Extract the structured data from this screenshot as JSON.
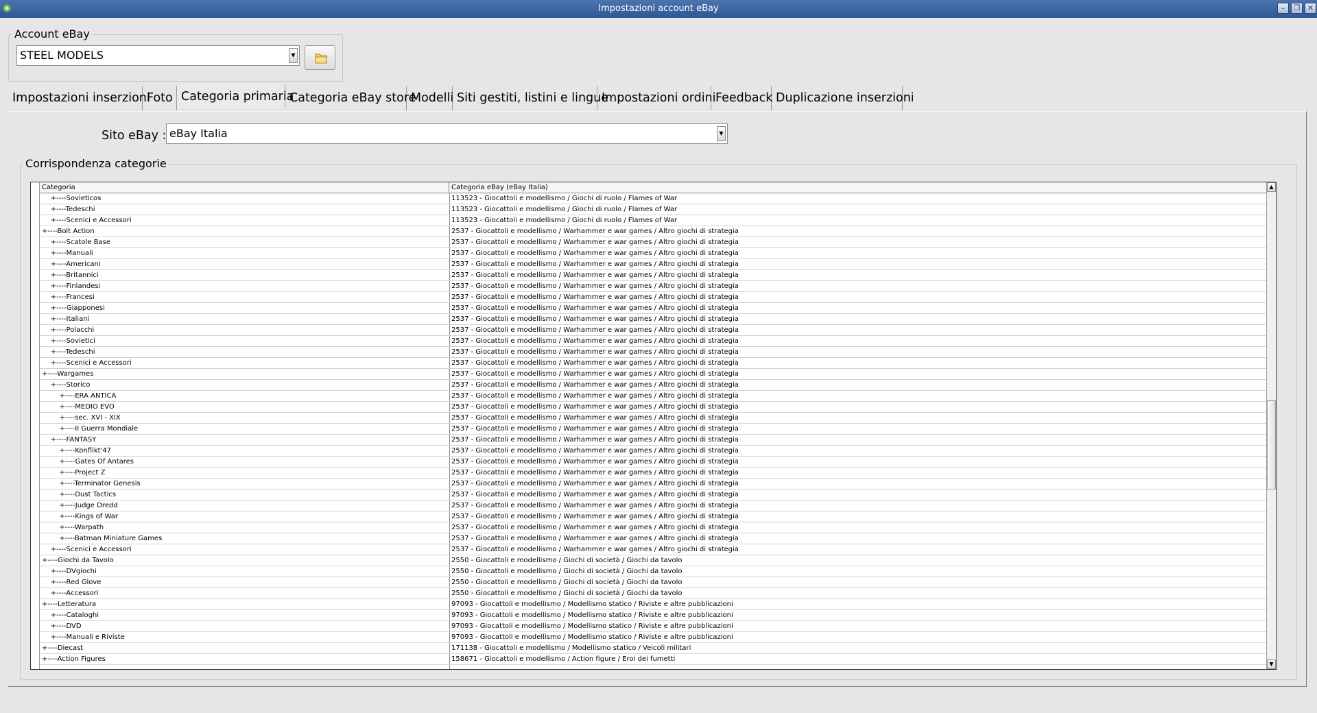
{
  "window": {
    "title": "Impostazioni account eBay",
    "buttons": {
      "minimize": "–",
      "restore": "❐",
      "close": "✕"
    }
  },
  "account": {
    "legend": "Account eBay",
    "selected": "STEEL MODELS",
    "folder_icon": "folder-icon"
  },
  "tabs": [
    {
      "label": "Impostazioni inserzioni"
    },
    {
      "label": "Foto"
    },
    {
      "label": "Categoria primaria"
    },
    {
      "label": "Categoria eBay store"
    },
    {
      "label": "Modelli"
    },
    {
      "label": "Siti gestiti, listini e lingue"
    },
    {
      "label": "Impostazioni ordini"
    },
    {
      "label": "Feedback"
    },
    {
      "label": "Duplicazione inserzioni"
    }
  ],
  "active_tab": "Categoria primaria",
  "sito": {
    "label": "Sito eBay :",
    "selected": "eBay Italia"
  },
  "corrispondenza": {
    "legend": "Corrispondenza categorie",
    "columns": [
      "Categoria",
      "Categoria eBay (eBay Italia)"
    ],
    "rows": [
      [
        "    +----Sovieticos",
        "113523 - Giocattoli e modellismo / Giochi di ruolo / Flames of War"
      ],
      [
        "    +----Tedeschi",
        "113523 - Giocattoli e modellismo / Giochi di ruolo / Flames of War"
      ],
      [
        "    +----Scenici e Accessori",
        "113523 - Giocattoli e modellismo / Giochi di ruolo / Flames of War"
      ],
      [
        "+----Bolt Action",
        "2537 - Giocattoli e modellismo / Warhammer e war games / Altro giochi di strategia"
      ],
      [
        "    +----Scatole Base",
        "2537 - Giocattoli e modellismo / Warhammer e war games / Altro giochi di strategia"
      ],
      [
        "    +----Manuali",
        "2537 - Giocattoli e modellismo / Warhammer e war games / Altro giochi di strategia"
      ],
      [
        "    +----Americani",
        "2537 - Giocattoli e modellismo / Warhammer e war games / Altro giochi di strategia"
      ],
      [
        "    +----Britannici",
        "2537 - Giocattoli e modellismo / Warhammer e war games / Altro giochi di strategia"
      ],
      [
        "    +----Finlandesi",
        "2537 - Giocattoli e modellismo / Warhammer e war games / Altro giochi di strategia"
      ],
      [
        "    +----Francesi",
        "2537 - Giocattoli e modellismo / Warhammer e war games / Altro giochi di strategia"
      ],
      [
        "    +----Giapponesi",
        "2537 - Giocattoli e modellismo / Warhammer e war games / Altro giochi di strategia"
      ],
      [
        "    +----Italiani",
        "2537 - Giocattoli e modellismo / Warhammer e war games / Altro giochi di strategia"
      ],
      [
        "    +----Polacchi",
        "2537 - Giocattoli e modellismo / Warhammer e war games / Altro giochi di strategia"
      ],
      [
        "    +----Sovietici",
        "2537 - Giocattoli e modellismo / Warhammer e war games / Altro giochi di strategia"
      ],
      [
        "    +----Tedeschi",
        "2537 - Giocattoli e modellismo / Warhammer e war games / Altro giochi di strategia"
      ],
      [
        "    +----Scenici e Accessori",
        "2537 - Giocattoli e modellismo / Warhammer e war games / Altro giochi di strategia"
      ],
      [
        "+----Wargames",
        "2537 - Giocattoli e modellismo / Warhammer e war games / Altro giochi di strategia"
      ],
      [
        "    +----Storico",
        "2537 - Giocattoli e modellismo / Warhammer e war games / Altro giochi di strategia"
      ],
      [
        "        +----ERA ANTICA",
        "2537 - Giocattoli e modellismo / Warhammer e war games / Altro giochi di strategia"
      ],
      [
        "        +----MEDIO EVO",
        "2537 - Giocattoli e modellismo / Warhammer e war games / Altro giochi di strategia"
      ],
      [
        "        +----sec. XVI - XIX",
        "2537 - Giocattoli e modellismo / Warhammer e war games / Altro giochi di strategia"
      ],
      [
        "        +----II Guerra Mondiale",
        "2537 - Giocattoli e modellismo / Warhammer e war games / Altro giochi di strategia"
      ],
      [
        "    +----FANTASY",
        "2537 - Giocattoli e modellismo / Warhammer e war games / Altro giochi di strategia"
      ],
      [
        "        +----Konflikt'47",
        "2537 - Giocattoli e modellismo / Warhammer e war games / Altro giochi di strategia"
      ],
      [
        "        +----Gates Of Antares",
        "2537 - Giocattoli e modellismo / Warhammer e war games / Altro giochi di strategia"
      ],
      [
        "        +----Project Z",
        "2537 - Giocattoli e modellismo / Warhammer e war games / Altro giochi di strategia"
      ],
      [
        "        +----Terminator Genesis",
        "2537 - Giocattoli e modellismo / Warhammer e war games / Altro giochi di strategia"
      ],
      [
        "        +----Dust Tactics",
        "2537 - Giocattoli e modellismo / Warhammer e war games / Altro giochi di strategia"
      ],
      [
        "        +----Judge Dredd",
        "2537 - Giocattoli e modellismo / Warhammer e war games / Altro giochi di strategia"
      ],
      [
        "        +----Kings of War",
        "2537 - Giocattoli e modellismo / Warhammer e war games / Altro giochi di strategia"
      ],
      [
        "        +----Warpath",
        "2537 - Giocattoli e modellismo / Warhammer e war games / Altro giochi di strategia"
      ],
      [
        "        +----Batman Miniature Games",
        "2537 - Giocattoli e modellismo / Warhammer e war games / Altro giochi di strategia"
      ],
      [
        "    +----Scenici e Accessori",
        "2537 - Giocattoli e modellismo / Warhammer e war games / Altro giochi di strategia"
      ],
      [
        "+----Giochi da Tavolo",
        "2550 - Giocattoli e modellismo / Giochi di società / Giochi da tavolo"
      ],
      [
        "    +----DVgiochi",
        "2550 - Giocattoli e modellismo / Giochi di società / Giochi da tavolo"
      ],
      [
        "    +----Red Glove",
        "2550 - Giocattoli e modellismo / Giochi di società / Giochi da tavolo"
      ],
      [
        "    +----Accessori",
        "2550 - Giocattoli e modellismo / Giochi di società / Giochi da tavolo"
      ],
      [
        "+----Letteratura",
        "97093 - Giocattoli e modellismo / Modellismo statico / Riviste e altre pubblicazioni"
      ],
      [
        "    +----Cataloghi",
        "97093 - Giocattoli e modellismo / Modellismo statico / Riviste e altre pubblicazioni"
      ],
      [
        "    +----DVD",
        "97093 - Giocattoli e modellismo / Modellismo statico / Riviste e altre pubblicazioni"
      ],
      [
        "    +----Manuali e Riviste",
        "97093 - Giocattoli e modellismo / Modellismo statico / Riviste e altre pubblicazioni"
      ],
      [
        "+----Diecast",
        "171138 - Giocattoli e modellismo / Modellismo statico / Veicoli militari"
      ],
      [
        "+----Action Figures",
        "158671 - Giocattoli e modellismo / Action figure / Eroi dei fumetti"
      ]
    ]
  },
  "scrollbar": {
    "up_arrow": "▲",
    "down_arrow": "▼",
    "position": 0.55
  }
}
